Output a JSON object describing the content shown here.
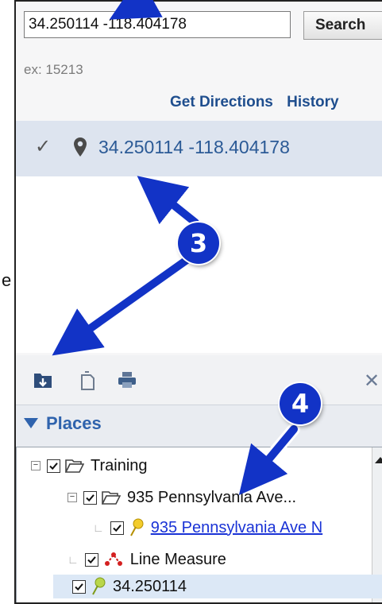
{
  "search": {
    "value": "34.250114 -118.404178",
    "button_label": "Search",
    "hint": "ex: 15213"
  },
  "links": {
    "get_directions": "Get Directions",
    "history": "History"
  },
  "result": {
    "coordinates": "34.250114 -118.404178"
  },
  "stray_text": "e",
  "toolbar": {
    "icons": [
      "folder-add-icon",
      "copy-icon",
      "print-icon",
      "close-icon"
    ]
  },
  "places": {
    "title": "Places",
    "items": [
      {
        "label": "Training",
        "type": "folder",
        "checked": true,
        "expanded": true
      },
      {
        "label": "935 Pennsylvania Ave...",
        "type": "folder",
        "checked": true,
        "expanded": true
      },
      {
        "label": "935 Pennsylvania Ave N",
        "type": "placemark-link",
        "checked": true
      },
      {
        "label": "Line Measure",
        "type": "path",
        "checked": true
      },
      {
        "label": "34.250114",
        "type": "placemark",
        "checked": true,
        "selected": true
      }
    ]
  },
  "annotations": {
    "badge_3": "3",
    "badge_4": "4"
  },
  "colors": {
    "annotation_blue": "#1233c6",
    "link_blue": "#2b5a96",
    "header_blue": "#2f63ad"
  }
}
